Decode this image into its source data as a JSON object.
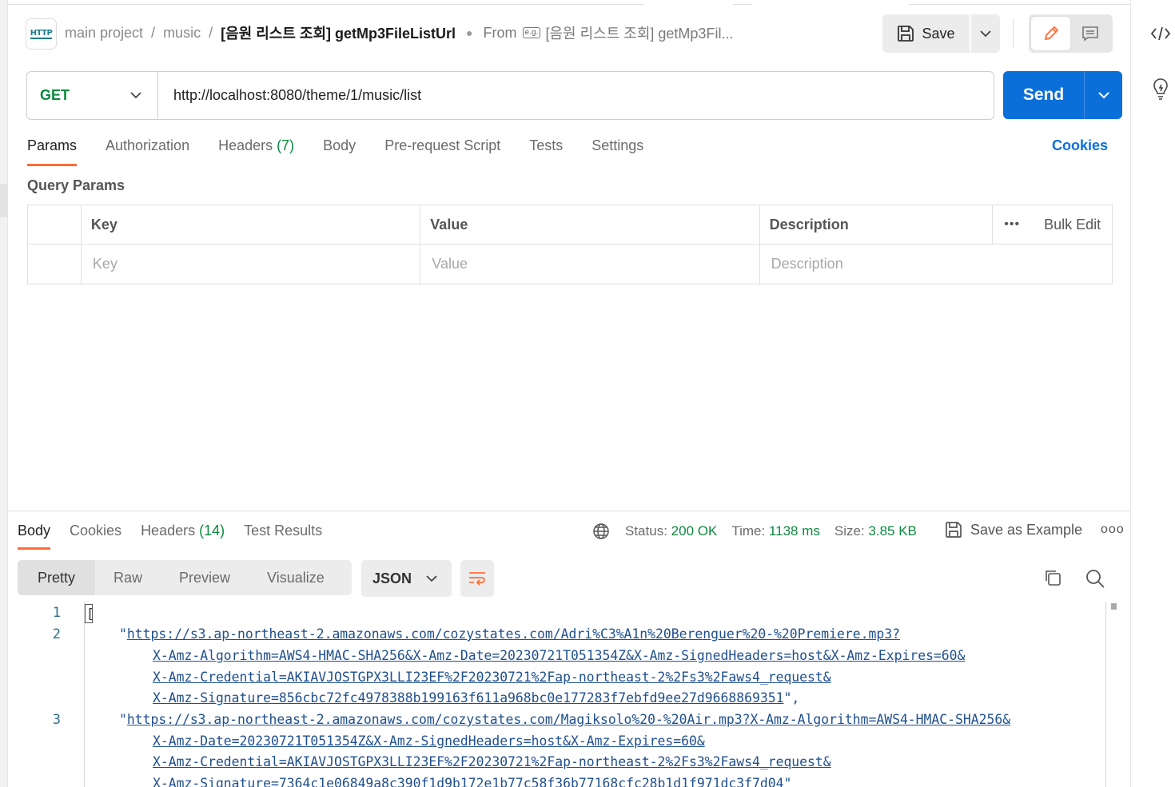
{
  "header": {
    "badge": "HTTP",
    "breadcrumb": {
      "workspace": "main project",
      "folder": "music",
      "request": "[음원 리스트 조회] getMp3FileListUrl",
      "from_label": "From",
      "example_badge": "e.g.",
      "example_name": "[음원 리스트 조회] getMp3Fil..."
    },
    "save_label": "Save"
  },
  "request": {
    "method": "GET",
    "url": "http://localhost:8080/theme/1/music/list",
    "send_label": "Send",
    "tabs": [
      {
        "label": "Params",
        "count": ""
      },
      {
        "label": "Authorization",
        "count": ""
      },
      {
        "label": "Headers",
        "count": "(7)"
      },
      {
        "label": "Body",
        "count": ""
      },
      {
        "label": "Pre-request Script",
        "count": ""
      },
      {
        "label": "Tests",
        "count": ""
      },
      {
        "label": "Settings",
        "count": ""
      }
    ],
    "cookies_link": "Cookies"
  },
  "params": {
    "title": "Query Params",
    "columns": [
      "Key",
      "Value",
      "Description"
    ],
    "bulk_edit": "Bulk Edit",
    "more": "•••",
    "placeholders": {
      "key": "Key",
      "value": "Value",
      "description": "Description"
    }
  },
  "response": {
    "tabs": [
      {
        "label": "Body",
        "count": ""
      },
      {
        "label": "Cookies",
        "count": ""
      },
      {
        "label": "Headers",
        "count": "(14)"
      },
      {
        "label": "Test Results",
        "count": ""
      }
    ],
    "status_label": "Status:",
    "status_value": "200 OK",
    "time_label": "Time:",
    "time_value": "1138 ms",
    "size_label": "Size:",
    "size_value": "3.85 KB",
    "save_example": "Save as Example",
    "more": "ooo",
    "views": [
      "Pretty",
      "Raw",
      "Preview",
      "Visualize"
    ],
    "format": "JSON",
    "code": {
      "line_numbers": [
        "1",
        "2",
        "3"
      ],
      "open_bracket": "[",
      "lines": [
        {
          "prefix": "\"",
          "link": "https://s3.ap-northeast-2.amazonaws.com/cozystates.com/Adri%C3%A1n%20Berenguer%20-%20Premiere.mp3?",
          "suffix": ""
        },
        {
          "prefix": "",
          "link": "X-Amz-Algorithm=AWS4-HMAC-SHA256&X-Amz-Date=20230721T051354Z&X-Amz-SignedHeaders=host&X-Amz-Expires=60&",
          "suffix": ""
        },
        {
          "prefix": "",
          "link": "X-Amz-Credential=AKIAVJOSTGPX3LLI23EF%2F20230721%2Fap-northeast-2%2Fs3%2Faws4_request&",
          "suffix": ""
        },
        {
          "prefix": "",
          "link": "X-Amz-Signature=856cbc72fc4978388b199163f611a968bc0e177283f7ebfd9ee27d9668869351",
          "suffix": "\","
        },
        {
          "prefix": "\"",
          "link": "https://s3.ap-northeast-2.amazonaws.com/cozystates.com/Magiksolo%20-%20Air.mp3?X-Amz-Algorithm=AWS4-HMAC-SHA256&",
          "suffix": ""
        },
        {
          "prefix": "",
          "link": "X-Amz-Date=20230721T051354Z&X-Amz-SignedHeaders=host&X-Amz-Expires=60&",
          "suffix": ""
        },
        {
          "prefix": "",
          "link": "X-Amz-Credential=AKIAVJOSTGPX3LLI23EF%2F20230721%2Fap-northeast-2%2Fs3%2Faws4_request&",
          "suffix": ""
        },
        {
          "prefix": "",
          "link": "X-Amz-Signature=7364c1e06849a8c390f1d9b172e1b77c58f36b77168cfc28b1d1f971dc3f7d04",
          "suffix": "\""
        }
      ]
    }
  },
  "colors": {
    "accent": "#ff6c37",
    "send": "#0b6fd9",
    "method": "#0b8a3e",
    "status_ok": "#0b8a3e",
    "link": "#1f4f8f"
  },
  "icons": [
    "http-icon",
    "save-icon",
    "chevron-down-icon",
    "pencil-icon",
    "comment-icon",
    "code-icon",
    "lightbulb-icon",
    "globe-icon",
    "wrap-icon",
    "copy-icon",
    "search-icon"
  ]
}
